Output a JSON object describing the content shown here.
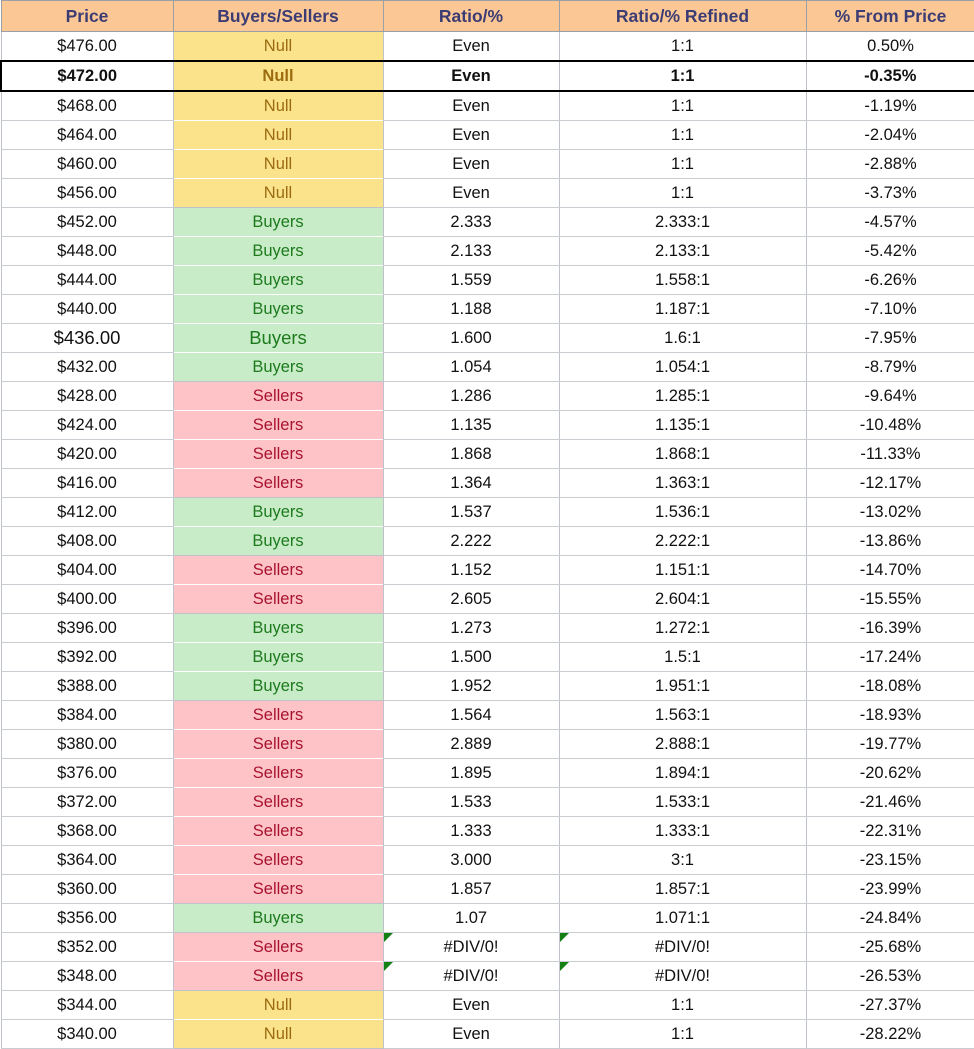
{
  "table": {
    "columns": [
      {
        "key": "price",
        "label": "Price"
      },
      {
        "key": "buyers_sellers",
        "label": "Buyers/Sellers"
      },
      {
        "key": "ratio",
        "label": "Ratio/%"
      },
      {
        "key": "ratio_refined",
        "label": "Ratio/% Refined"
      },
      {
        "key": "pct_from_price",
        "label": "% From Price"
      }
    ],
    "colors": {
      "header_fill": "#FBC895",
      "header_text": "#3C3C74",
      "null_fill": "#FBE38C",
      "null_text": "#9C6B10",
      "buyers_fill": "#C8ECC8",
      "buyers_text": "#1D7A1D",
      "sellers_fill": "#FDC3C6",
      "sellers_text": "#A81230",
      "grid_line": "#C9CCD1",
      "highlight_border": "#000000",
      "error_flag": "#128012"
    },
    "rows": [
      {
        "price": "$476.00",
        "buyers_sellers": "Null",
        "ratio": "Even",
        "ratio_refined": "1:1",
        "pct_from_price": "0.50%",
        "fill": "null",
        "highlight": false,
        "big": false,
        "error": false
      },
      {
        "price": "$472.00",
        "buyers_sellers": "Null",
        "ratio": "Even",
        "ratio_refined": "1:1",
        "pct_from_price": "-0.35%",
        "fill": "null",
        "highlight": true,
        "big": false,
        "error": false
      },
      {
        "price": "$468.00",
        "buyers_sellers": "Null",
        "ratio": "Even",
        "ratio_refined": "1:1",
        "pct_from_price": "-1.19%",
        "fill": "null",
        "highlight": false,
        "big": false,
        "error": false
      },
      {
        "price": "$464.00",
        "buyers_sellers": "Null",
        "ratio": "Even",
        "ratio_refined": "1:1",
        "pct_from_price": "-2.04%",
        "fill": "null",
        "highlight": false,
        "big": false,
        "error": false
      },
      {
        "price": "$460.00",
        "buyers_sellers": "Null",
        "ratio": "Even",
        "ratio_refined": "1:1",
        "pct_from_price": "-2.88%",
        "fill": "null",
        "highlight": false,
        "big": false,
        "error": false
      },
      {
        "price": "$456.00",
        "buyers_sellers": "Null",
        "ratio": "Even",
        "ratio_refined": "1:1",
        "pct_from_price": "-3.73%",
        "fill": "null",
        "highlight": false,
        "big": false,
        "error": false
      },
      {
        "price": "$452.00",
        "buyers_sellers": "Buyers",
        "ratio": "2.333",
        "ratio_refined": "2.333:1",
        "pct_from_price": "-4.57%",
        "fill": "buyers",
        "highlight": false,
        "big": false,
        "error": false
      },
      {
        "price": "$448.00",
        "buyers_sellers": "Buyers",
        "ratio": "2.133",
        "ratio_refined": "2.133:1",
        "pct_from_price": "-5.42%",
        "fill": "buyers",
        "highlight": false,
        "big": false,
        "error": false
      },
      {
        "price": "$444.00",
        "buyers_sellers": "Buyers",
        "ratio": "1.559",
        "ratio_refined": "1.558:1",
        "pct_from_price": "-6.26%",
        "fill": "buyers",
        "highlight": false,
        "big": false,
        "error": false
      },
      {
        "price": "$440.00",
        "buyers_sellers": "Buyers",
        "ratio": "1.188",
        "ratio_refined": "1.187:1",
        "pct_from_price": "-7.10%",
        "fill": "buyers",
        "highlight": false,
        "big": false,
        "error": false
      },
      {
        "price": "$436.00",
        "buyers_sellers": "Buyers",
        "ratio": "1.600",
        "ratio_refined": "1.6:1",
        "pct_from_price": "-7.95%",
        "fill": "buyers",
        "highlight": false,
        "big": true,
        "error": false
      },
      {
        "price": "$432.00",
        "buyers_sellers": "Buyers",
        "ratio": "1.054",
        "ratio_refined": "1.054:1",
        "pct_from_price": "-8.79%",
        "fill": "buyers",
        "highlight": false,
        "big": false,
        "error": false
      },
      {
        "price": "$428.00",
        "buyers_sellers": "Sellers",
        "ratio": "1.286",
        "ratio_refined": "1.285:1",
        "pct_from_price": "-9.64%",
        "fill": "sellers",
        "highlight": false,
        "big": false,
        "error": false
      },
      {
        "price": "$424.00",
        "buyers_sellers": "Sellers",
        "ratio": "1.135",
        "ratio_refined": "1.135:1",
        "pct_from_price": "-10.48%",
        "fill": "sellers",
        "highlight": false,
        "big": false,
        "error": false
      },
      {
        "price": "$420.00",
        "buyers_sellers": "Sellers",
        "ratio": "1.868",
        "ratio_refined": "1.868:1",
        "pct_from_price": "-11.33%",
        "fill": "sellers",
        "highlight": false,
        "big": false,
        "error": false
      },
      {
        "price": "$416.00",
        "buyers_sellers": "Sellers",
        "ratio": "1.364",
        "ratio_refined": "1.363:1",
        "pct_from_price": "-12.17%",
        "fill": "sellers",
        "highlight": false,
        "big": false,
        "error": false
      },
      {
        "price": "$412.00",
        "buyers_sellers": "Buyers",
        "ratio": "1.537",
        "ratio_refined": "1.536:1",
        "pct_from_price": "-13.02%",
        "fill": "buyers",
        "highlight": false,
        "big": false,
        "error": false
      },
      {
        "price": "$408.00",
        "buyers_sellers": "Buyers",
        "ratio": "2.222",
        "ratio_refined": "2.222:1",
        "pct_from_price": "-13.86%",
        "fill": "buyers",
        "highlight": false,
        "big": false,
        "error": false
      },
      {
        "price": "$404.00",
        "buyers_sellers": "Sellers",
        "ratio": "1.152",
        "ratio_refined": "1.151:1",
        "pct_from_price": "-14.70%",
        "fill": "sellers",
        "highlight": false,
        "big": false,
        "error": false
      },
      {
        "price": "$400.00",
        "buyers_sellers": "Sellers",
        "ratio": "2.605",
        "ratio_refined": "2.604:1",
        "pct_from_price": "-15.55%",
        "fill": "sellers",
        "highlight": false,
        "big": false,
        "error": false
      },
      {
        "price": "$396.00",
        "buyers_sellers": "Buyers",
        "ratio": "1.273",
        "ratio_refined": "1.272:1",
        "pct_from_price": "-16.39%",
        "fill": "buyers",
        "highlight": false,
        "big": false,
        "error": false
      },
      {
        "price": "$392.00",
        "buyers_sellers": "Buyers",
        "ratio": "1.500",
        "ratio_refined": "1.5:1",
        "pct_from_price": "-17.24%",
        "fill": "buyers",
        "highlight": false,
        "big": false,
        "error": false
      },
      {
        "price": "$388.00",
        "buyers_sellers": "Buyers",
        "ratio": "1.952",
        "ratio_refined": "1.951:1",
        "pct_from_price": "-18.08%",
        "fill": "buyers",
        "highlight": false,
        "big": false,
        "error": false
      },
      {
        "price": "$384.00",
        "buyers_sellers": "Sellers",
        "ratio": "1.564",
        "ratio_refined": "1.563:1",
        "pct_from_price": "-18.93%",
        "fill": "sellers",
        "highlight": false,
        "big": false,
        "error": false
      },
      {
        "price": "$380.00",
        "buyers_sellers": "Sellers",
        "ratio": "2.889",
        "ratio_refined": "2.888:1",
        "pct_from_price": "-19.77%",
        "fill": "sellers",
        "highlight": false,
        "big": false,
        "error": false
      },
      {
        "price": "$376.00",
        "buyers_sellers": "Sellers",
        "ratio": "1.895",
        "ratio_refined": "1.894:1",
        "pct_from_price": "-20.62%",
        "fill": "sellers",
        "highlight": false,
        "big": false,
        "error": false
      },
      {
        "price": "$372.00",
        "buyers_sellers": "Sellers",
        "ratio": "1.533",
        "ratio_refined": "1.533:1",
        "pct_from_price": "-21.46%",
        "fill": "sellers",
        "highlight": false,
        "big": false,
        "error": false
      },
      {
        "price": "$368.00",
        "buyers_sellers": "Sellers",
        "ratio": "1.333",
        "ratio_refined": "1.333:1",
        "pct_from_price": "-22.31%",
        "fill": "sellers",
        "highlight": false,
        "big": false,
        "error": false
      },
      {
        "price": "$364.00",
        "buyers_sellers": "Sellers",
        "ratio": "3.000",
        "ratio_refined": "3:1",
        "pct_from_price": "-23.15%",
        "fill": "sellers",
        "highlight": false,
        "big": false,
        "error": false
      },
      {
        "price": "$360.00",
        "buyers_sellers": "Sellers",
        "ratio": "1.857",
        "ratio_refined": "1.857:1",
        "pct_from_price": "-23.99%",
        "fill": "sellers",
        "highlight": false,
        "big": false,
        "error": false
      },
      {
        "price": "$356.00",
        "buyers_sellers": "Buyers",
        "ratio": "1.07",
        "ratio_refined": "1.071:1",
        "pct_from_price": "-24.84%",
        "fill": "buyers",
        "highlight": false,
        "big": false,
        "error": false
      },
      {
        "price": "$352.00",
        "buyers_sellers": "Sellers",
        "ratio": "#DIV/0!",
        "ratio_refined": "#DIV/0!",
        "pct_from_price": "-25.68%",
        "fill": "sellers",
        "highlight": false,
        "big": false,
        "error": true
      },
      {
        "price": "$348.00",
        "buyers_sellers": "Sellers",
        "ratio": "#DIV/0!",
        "ratio_refined": "#DIV/0!",
        "pct_from_price": "-26.53%",
        "fill": "sellers",
        "highlight": false,
        "big": false,
        "error": true
      },
      {
        "price": "$344.00",
        "buyers_sellers": "Null",
        "ratio": "Even",
        "ratio_refined": "1:1",
        "pct_from_price": "-27.37%",
        "fill": "null",
        "highlight": false,
        "big": false,
        "error": false
      },
      {
        "price": "$340.00",
        "buyers_sellers": "Null",
        "ratio": "Even",
        "ratio_refined": "1:1",
        "pct_from_price": "-28.22%",
        "fill": "null",
        "highlight": false,
        "big": false,
        "error": false
      }
    ]
  }
}
